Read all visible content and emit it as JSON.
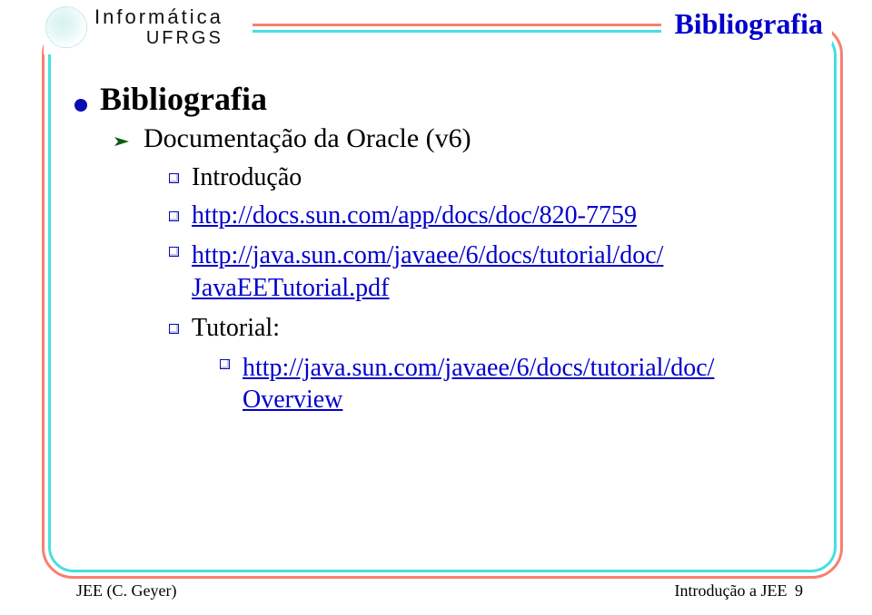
{
  "header": {
    "logo_top": "Informática",
    "logo_sub": "UFRGS",
    "slide_title": "Bibliografia"
  },
  "content": {
    "lvl1": "Bibliografia",
    "lvl2": "Documentação da Oracle (v6)",
    "items": [
      {
        "label": "Introdução"
      },
      {
        "link": "http://docs.sun.com/app/docs/doc/820-7759"
      },
      {
        "link_multiline": [
          "http://java.sun.com/javaee/6/docs/tutorial/doc/",
          "JavaEETutorial.pdf"
        ]
      },
      {
        "label": "Tutorial:"
      }
    ],
    "sub_items": [
      {
        "link_multiline": [
          "http://java.sun.com/javaee/6/docs/tutorial/doc/",
          "Overview"
        ]
      }
    ]
  },
  "footer": {
    "left": "JEE (C. Geyer)",
    "right_prefix": "Introdução a JEE",
    "page": "9"
  }
}
